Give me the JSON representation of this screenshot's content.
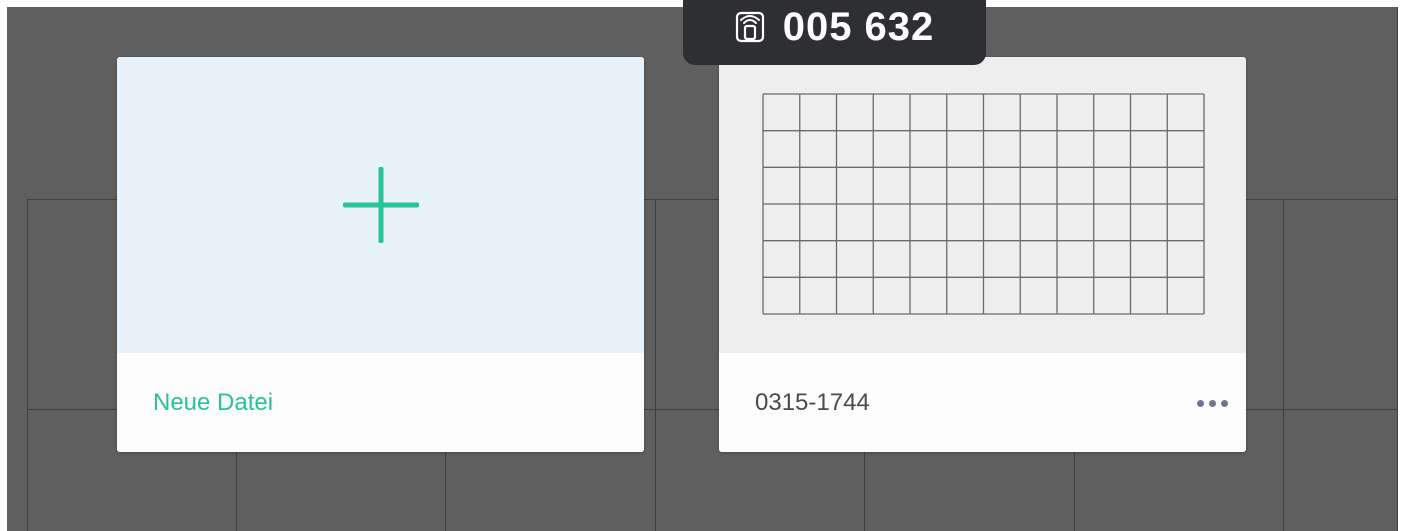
{
  "session": {
    "code": "005 632",
    "icon": "screen-cast-icon"
  },
  "cards": {
    "new_file": {
      "label": "Neue Datei",
      "icon": "plus-icon",
      "accent_color": "#27c39a"
    },
    "file": {
      "name": "0315-1744",
      "menu_icon": "more-options-icon"
    }
  },
  "colors": {
    "background": "#5f5f5f",
    "pill": "#2d2f33",
    "new_file_thumb": "#e8f2fb",
    "file_thumb": "#eeeeee"
  }
}
